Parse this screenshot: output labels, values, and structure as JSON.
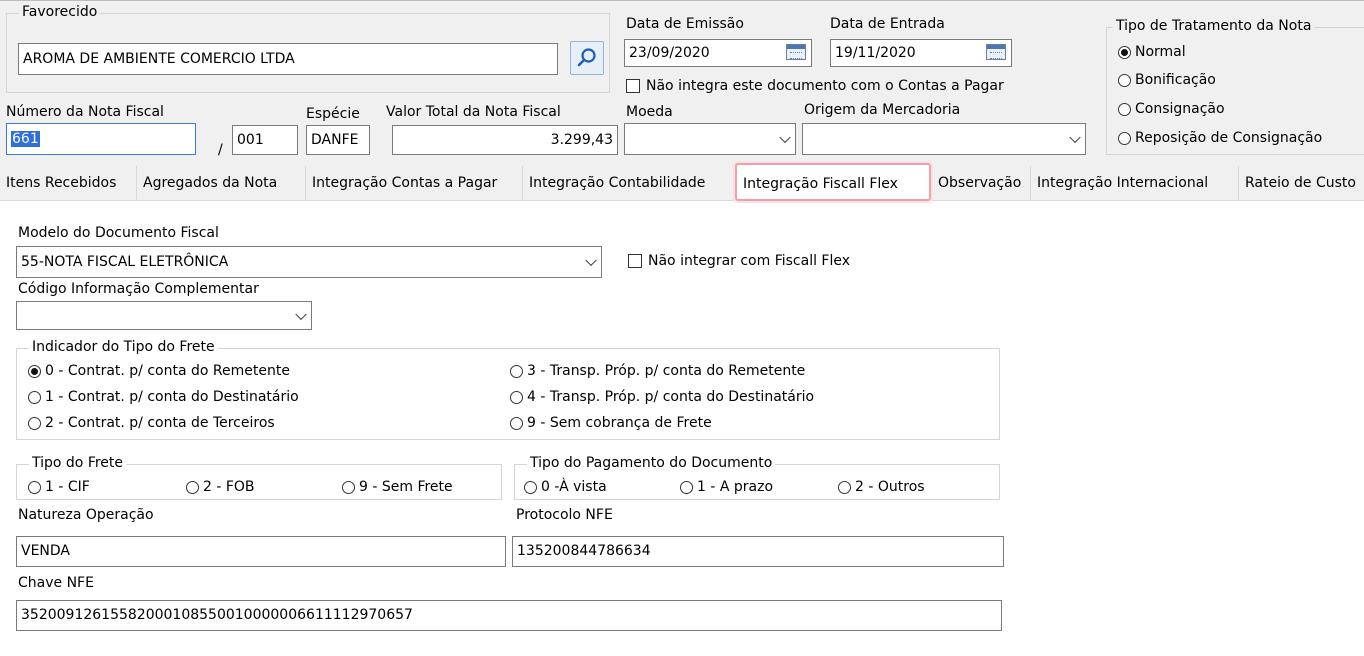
{
  "header": {
    "favorecido_label": "Favorecido",
    "favorecido_value": "AROMA DE AMBIENTE COMERCIO LTDA",
    "data_emissao_label": "Data de Emissão",
    "data_emissao_value": "23/09/2020",
    "data_entrada_label": "Data de Entrada",
    "data_entrada_value": "19/11/2020",
    "nao_integra_label": "Não integra este documento com o Contas a Pagar",
    "numero_nf_label": "Número da Nota Fiscal",
    "numero_nf_value": "661",
    "serie_sep": "/",
    "serie_value": "001",
    "especie_label": "Espécie",
    "especie_value": "DANFE",
    "valor_total_label": "Valor Total da Nota Fiscal",
    "valor_total_value": "3.299,43",
    "moeda_label": "Moeda",
    "moeda_value": "",
    "origem_label": "Origem da Mercadoria",
    "origem_value": ""
  },
  "tratamento": {
    "title": "Tipo de Tratamento da Nota",
    "options": [
      "Normal",
      "Bonificação",
      "Consignação",
      "Reposição de Consignação"
    ],
    "selected": "Normal"
  },
  "tabs": [
    "Itens Recebidos",
    "Agregados da Nota",
    "Integração Contas a Pagar",
    "Integração Contabilidade",
    "Integração Fiscall Flex",
    "Observação",
    "Integração Internacional",
    "Rateio de Custo"
  ],
  "active_tab": "Integração Fiscall Flex",
  "fiscal": {
    "modelo_label": "Modelo do Documento Fiscal",
    "modelo_value": "55-NOTA FISCAL ELETRÔNICA",
    "nao_integrar_label": "Não integrar com Fiscall Flex",
    "codigo_info_label": "Código Informação Complementar",
    "codigo_info_value": "",
    "frete_indicador_title": "Indicador do Tipo do Frete",
    "frete_indicador_options": [
      "0 - Contrat. p/ conta do Remetente",
      "1 - Contrat. p/ conta do Destinatário",
      "2 - Contrat. p/ conta de Terceiros",
      "3 - Transp. Próp. p/ conta do Remetente",
      "4 - Transp. Próp. p/ conta do Destinatário",
      "9 - Sem cobrança de Frete"
    ],
    "tipo_frete_title": "Tipo do Frete",
    "tipo_frete_options": [
      "1 - CIF",
      "2 - FOB",
      "9 - Sem Frete"
    ],
    "tipo_pagamento_title": "Tipo do Pagamento do Documento",
    "tipo_pagamento_options": [
      "0 -À vista",
      "1 - A prazo",
      "2 - Outros"
    ],
    "natureza_label": "Natureza Operação",
    "natureza_value": "VENDA",
    "protocolo_label": "Protocolo NFE",
    "protocolo_value": "135200844786634",
    "chave_label": "Chave NFE",
    "chave_value": "35200912615582000108550010000006611112970657"
  }
}
